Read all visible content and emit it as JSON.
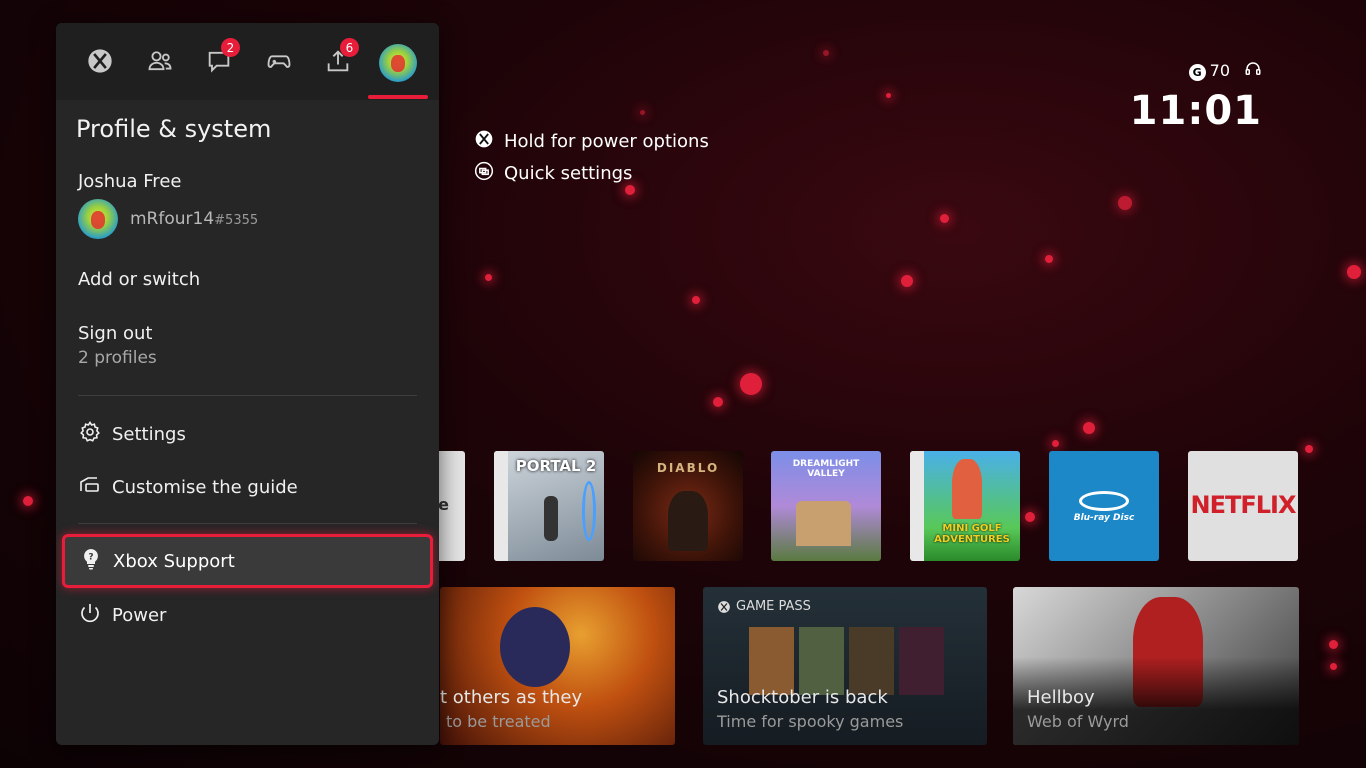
{
  "status": {
    "gamerscore": "70"
  },
  "clock": "11:01",
  "hints": [
    {
      "icon": "xbox-button-icon",
      "label": "Hold for power options"
    },
    {
      "icon": "view-button-icon",
      "label": "Quick settings"
    }
  ],
  "guide": {
    "tabs": [
      {
        "name": "xbox-home-icon"
      },
      {
        "name": "people-icon"
      },
      {
        "name": "chat-icon",
        "badge": "2"
      },
      {
        "name": "controller-icon"
      },
      {
        "name": "upload-icon",
        "badge": "6"
      },
      {
        "name": "profile-avatar-icon"
      }
    ],
    "section_title": "Profile & system",
    "profile": {
      "name": "Joshua Free",
      "gamertag": "mRfour14",
      "suffix": "#5355"
    },
    "add_switch": "Add or switch",
    "sign_out": {
      "label": "Sign out",
      "sub": "2 profiles"
    },
    "settings": "Settings",
    "customise": "Customise the guide",
    "support": "Xbox Support",
    "power": "Power"
  },
  "tiles": [
    {
      "name": "partial-tile",
      "label": "e"
    },
    {
      "name": "portal-2-tile",
      "label": "PORTAL 2"
    },
    {
      "name": "diablo-tile",
      "label": "DIABLO"
    },
    {
      "name": "dreamlight-valley-tile",
      "label": "DREAMLIGHT VALLEY"
    },
    {
      "name": "mini-golf-tile",
      "label": "MINI GOLF ADVENTURES"
    },
    {
      "name": "bluray-tile",
      "label": "Blu-ray Disc"
    },
    {
      "name": "netflix-tile",
      "label": "NETFLIX"
    }
  ],
  "cards": [
    {
      "title": "t others as they",
      "sub": "to be treated"
    },
    {
      "tag": "GAME PASS",
      "title": "Shocktober is back",
      "sub": "Time for spooky games"
    },
    {
      "title": "Hellboy",
      "sub": "Web of Wyrd"
    }
  ],
  "colors": {
    "accent": "#e81d3a",
    "panel": "#262626",
    "bluray": "#1c88c8",
    "netflix_bg": "#e0e0e0",
    "netflix_text": "#d0202a"
  }
}
